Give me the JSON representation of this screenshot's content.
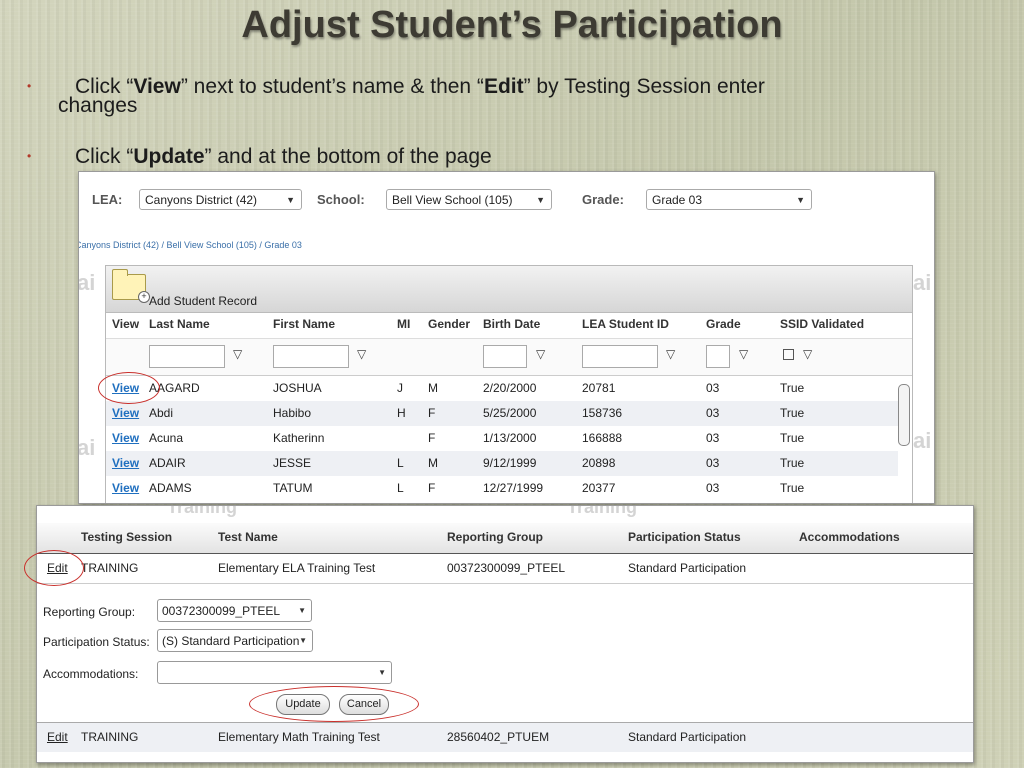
{
  "slide": {
    "title": "Adjust Student’s Participation",
    "bullet1": {
      "pre": "Click “",
      "bold1": "View",
      "mid": "” next to student’s name & then “",
      "bold2": "Edit",
      "post": "” by Testing Session enter",
      "wrap": "changes"
    },
    "bullet2": {
      "pre": "Click “",
      "bold": "Update",
      "post": "” and at the bottom of the page"
    }
  },
  "filters": {
    "lea_label": "LEA:",
    "lea_value": "Canyons District (42)",
    "school_label": "School:",
    "school_value": "Bell View School (105)",
    "grade_label": "Grade:",
    "grade_value": "Grade 03"
  },
  "breadcrumb": "Canyons District (42) / Bell View School (105) / Grade 03",
  "watermark_fragment": "ai",
  "watermark_text": "Training",
  "student_grid": {
    "add_record_label": "Add Student Record",
    "columns": [
      "View",
      "Last Name",
      "First Name",
      "MI",
      "Gender",
      "Birth Date",
      "LEA Student ID",
      "Grade",
      "SSID Validated"
    ],
    "rows": [
      [
        "View",
        "AAGARD",
        "JOSHUA",
        "J",
        "M",
        "2/20/2000",
        "20781",
        "03",
        "True"
      ],
      [
        "View",
        "Abdi",
        "Habibo",
        "H",
        "F",
        "5/25/2000",
        "158736",
        "03",
        "True"
      ],
      [
        "View",
        "Acuna",
        "Katherinn",
        "",
        "F",
        "1/13/2000",
        "166888",
        "03",
        "True"
      ],
      [
        "View",
        "ADAIR",
        "JESSE",
        "L",
        "M",
        "9/12/1999",
        "20898",
        "03",
        "True"
      ],
      [
        "View",
        "ADAMS",
        "TATUM",
        "L",
        "F",
        "12/27/1999",
        "20377",
        "03",
        "True"
      ]
    ]
  },
  "participation": {
    "columns": [
      "Testing Session",
      "Test Name",
      "Reporting Group",
      "Participation Status",
      "Accommodations"
    ],
    "row1": [
      "Edit",
      "TRAINING",
      "Elementary ELA Training Test",
      "00372300099_PTEEL",
      "Standard Participation"
    ],
    "editor": {
      "reporting_group_label": "Reporting Group:",
      "reporting_group_value": "00372300099_PTEEL",
      "participation_status_label": "Participation Status:",
      "participation_status_value": "(S) Standard Participation",
      "accommodations_label": "Accommodations:",
      "accommodations_value": "",
      "update_label": "Update",
      "cancel_label": "Cancel"
    },
    "row2": [
      "Edit",
      "TRAINING",
      "Elementary Math Training Test",
      "28560402_PTUEM",
      "Standard Participation"
    ]
  },
  "colors": {
    "highlight": "#c9302c",
    "link": "#1f6fbf",
    "bullet": "#b13a2a"
  }
}
